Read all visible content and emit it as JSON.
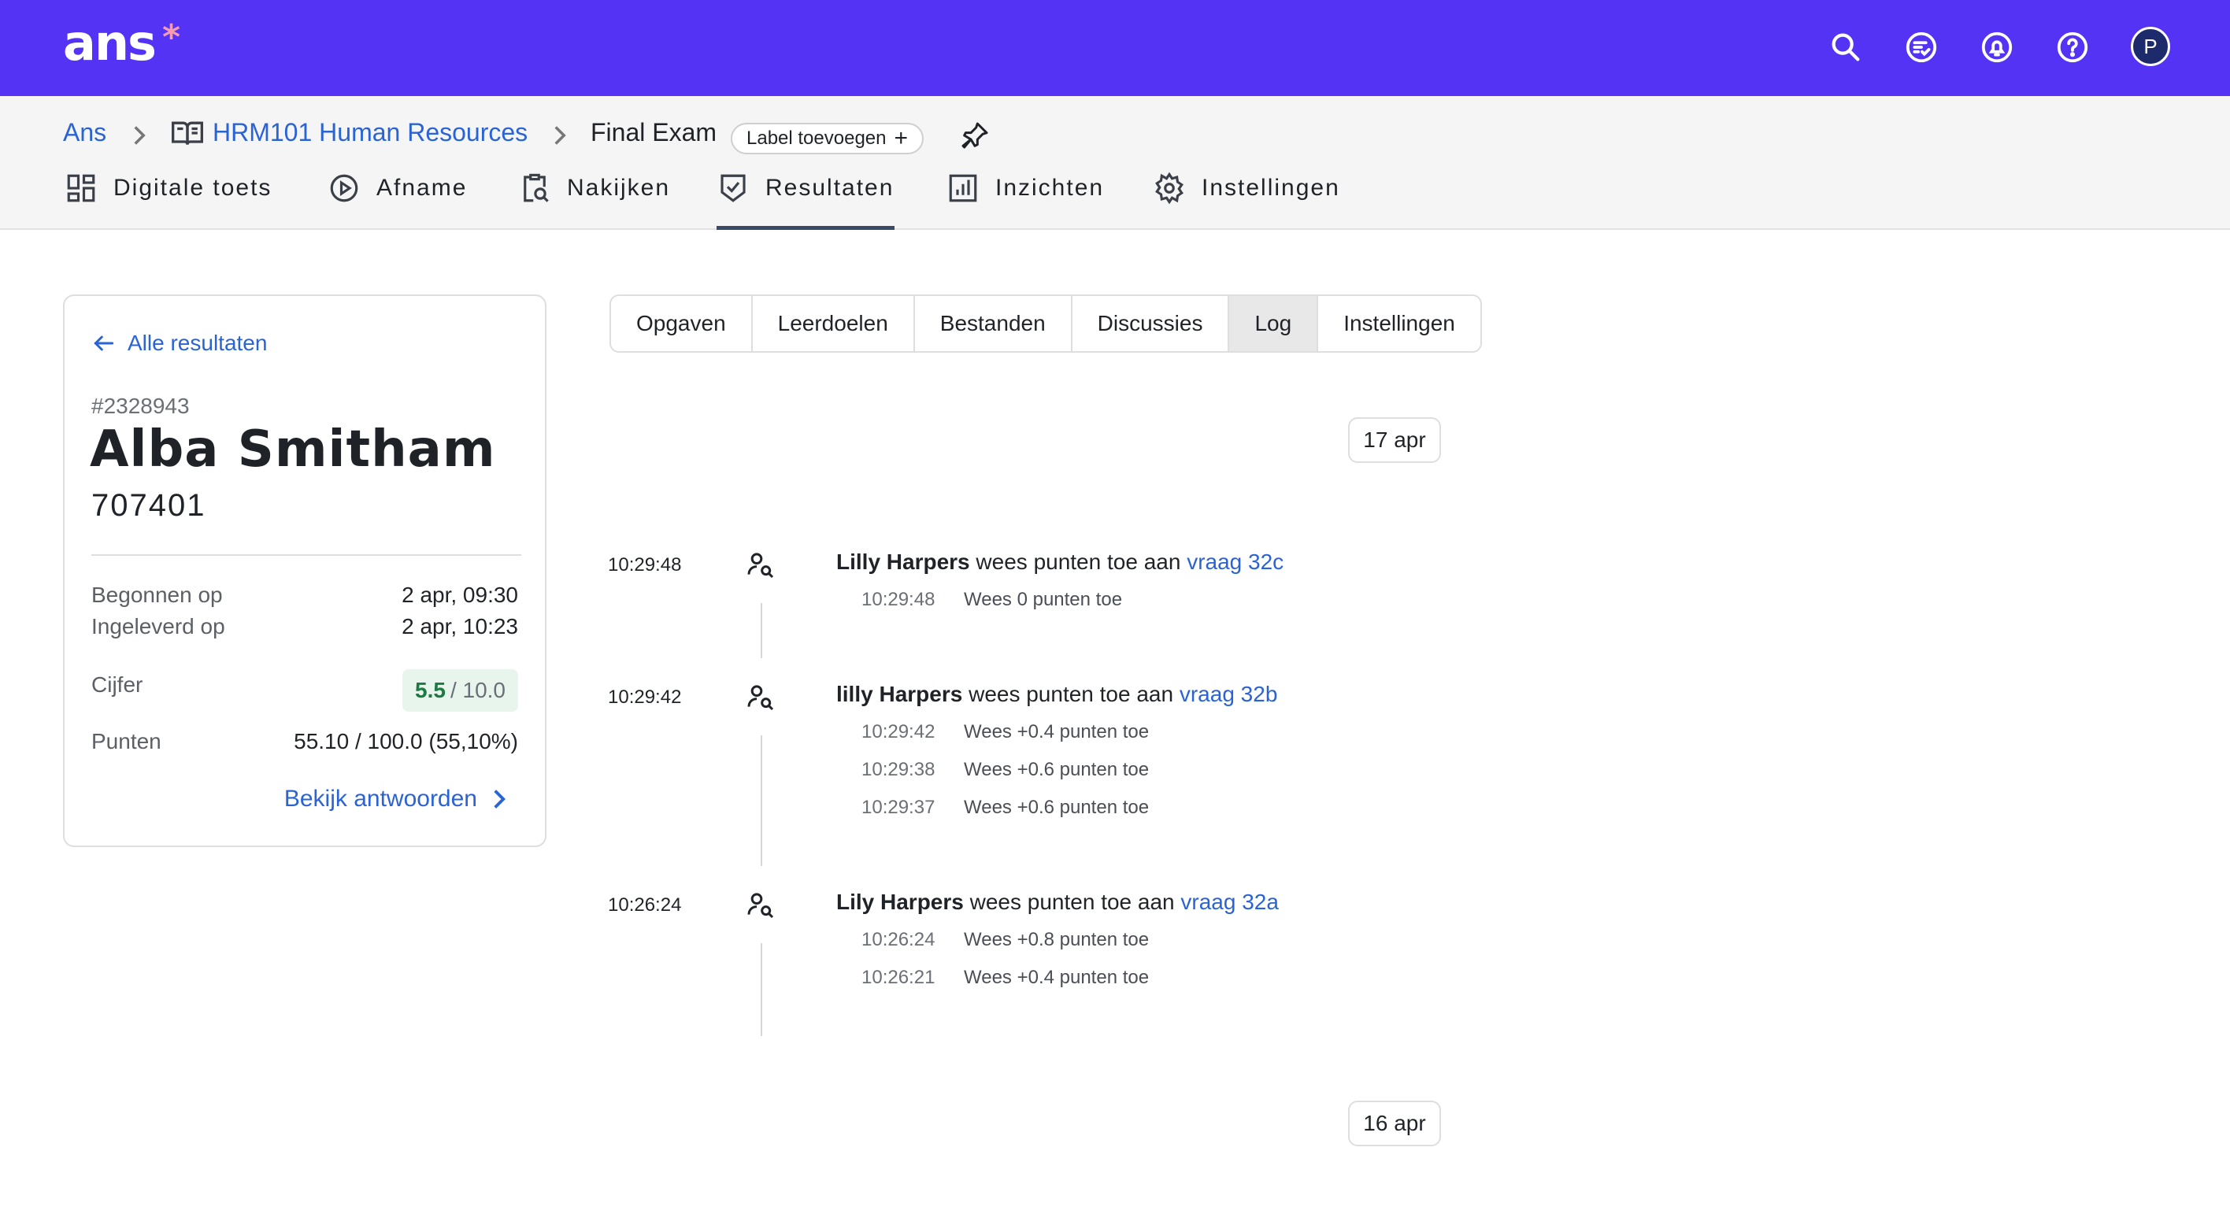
{
  "app": {
    "logo": "ans",
    "logo_mark": "*",
    "top_icons": [
      "search-icon",
      "tasks-icon",
      "notifications-icon",
      "help-icon"
    ],
    "avatar_initial": "P",
    "brand_color": "#5433f5"
  },
  "breadcrumb": {
    "root": "Ans",
    "course": "HRM101 Human Resources",
    "current": "Final Exam",
    "add_label": "Label toevoegen"
  },
  "nav": {
    "tabs": [
      {
        "label": "Digitale toets",
        "icon": "grid-icon"
      },
      {
        "label": "Afname",
        "icon": "play-icon"
      },
      {
        "label": "Nakijken",
        "icon": "clipboard-search-icon"
      },
      {
        "label": "Resultaten",
        "icon": "shield-check-icon",
        "active": true
      },
      {
        "label": "Inzichten",
        "icon": "chart-icon"
      },
      {
        "label": "Instellingen",
        "icon": "gear-icon"
      }
    ]
  },
  "result_card": {
    "back_label": "Alle resultaten",
    "id": "#2328943",
    "name": "Alba Smitham",
    "student_number": "707401",
    "started_label": "Begonnen op",
    "started_value": "2 apr, 09:30",
    "submitted_label": "Ingeleverd op",
    "submitted_value": "2 apr, 10:23",
    "grade_label": "Cijfer",
    "grade_value": "5.5",
    "grade_max": "/ 10.0",
    "points_label": "Punten",
    "points_value": "55.10 / 100.0 (55,10%)",
    "view_answers": "Bekijk antwoorden"
  },
  "subtabs": [
    {
      "label": "Opgaven"
    },
    {
      "label": "Leerdoelen"
    },
    {
      "label": "Bestanden"
    },
    {
      "label": "Discussies"
    },
    {
      "label": "Log",
      "active": true
    },
    {
      "label": "Instellingen"
    }
  ],
  "log": {
    "date_top": "17 apr",
    "date_bottom": "16 apr",
    "entries": [
      {
        "time": "10:29:48",
        "actor": "Lilly Harpers",
        "action": " wees punten toe aan ",
        "question": "vraag 32c",
        "details": [
          {
            "time": "10:29:48",
            "text": "Wees 0 punten toe"
          }
        ]
      },
      {
        "time": "10:29:42",
        "actor": "lilly Harpers",
        "action": " wees punten toe aan ",
        "question": "vraag 32b",
        "details": [
          {
            "time": "10:29:42",
            "text": "Wees +0.4 punten toe"
          },
          {
            "time": "10:29:38",
            "text": "Wees +0.6 punten toe"
          },
          {
            "time": "10:29:37",
            "text": "Wees +0.6 punten toe"
          }
        ]
      },
      {
        "time": "10:26:24",
        "actor": "Lily Harpers",
        "action": " wees punten toe aan ",
        "question": "vraag 32a",
        "details": [
          {
            "time": "10:26:24",
            "text": "Wees +0.8 punten toe"
          },
          {
            "time": "10:26:21",
            "text": "Wees +0.4 punten toe"
          }
        ]
      }
    ]
  }
}
